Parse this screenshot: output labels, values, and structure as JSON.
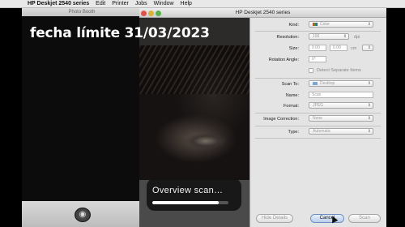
{
  "menubar": {
    "app_name": "HP Deskjet 2540 series",
    "items": [
      "Edit",
      "Printer",
      "Jobs",
      "Window",
      "Help"
    ]
  },
  "photobooth": {
    "title": "Photo Booth",
    "camera_glyph": "◉"
  },
  "dialog": {
    "title": "HP Deskjet 2540 series",
    "hud_text": "Overview scan…",
    "progress": 0.87,
    "kind_label": "Kind:",
    "kind_value": "Color",
    "resolution_label": "Resolution:",
    "resolution_value": "100",
    "resolution_unit": "dpi",
    "size_label": "Size:",
    "size_w": "0.00",
    "size_h": "0.00",
    "size_unit": "cm",
    "rotation_label": "Rotation Angle:",
    "rotation_value": "0°",
    "detect_label": "Detect Separate Items",
    "scan_to_label": "Scan To:",
    "scan_to_value": "Desktop",
    "name_label": "Name:",
    "name_value": "Scan",
    "format_label": "Format:",
    "format_value": "JPEG",
    "image_correction_label": "Image Correction:",
    "image_correction_value": "None",
    "type_label": "Type:",
    "type_value": "Automatic",
    "hide_details": "Hide Details",
    "cancel": "Cancel",
    "scan": "Scan"
  },
  "caption": "fecha límite 31/03/2023",
  "colors": {
    "traffic_red": "#e0524b",
    "traffic_yellow": "#d9b13a",
    "traffic_green": "#56b049"
  }
}
